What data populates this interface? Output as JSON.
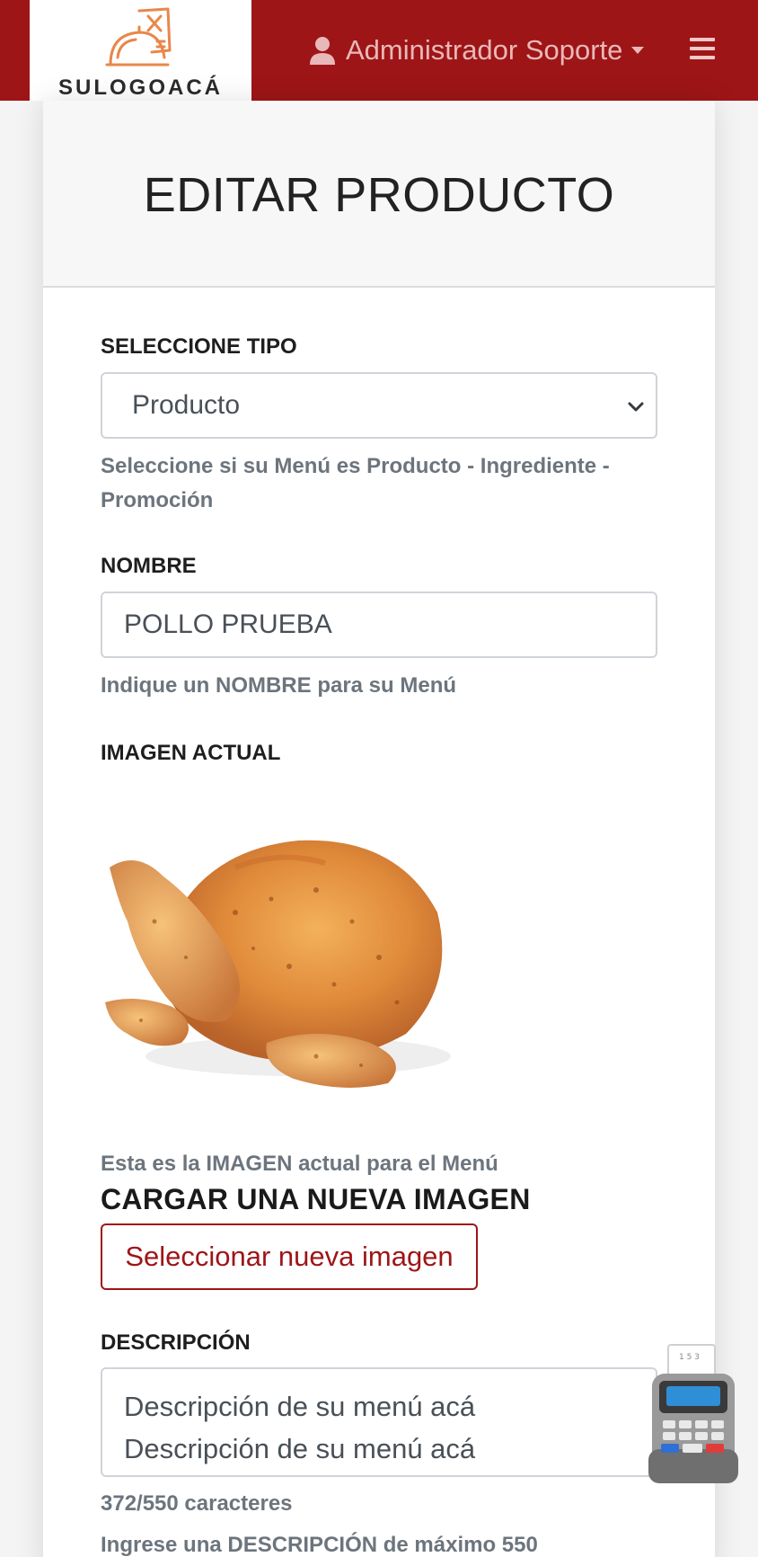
{
  "navbar": {
    "brand_name": "SULOGOACÁ",
    "user_name": "Administrador Soporte",
    "colors": {
      "primary": "#9e1517",
      "brand_bg": "#ffffff"
    }
  },
  "page": {
    "title": "EDITAR PRODUCTO"
  },
  "form": {
    "tipo": {
      "label": "SELECCIONE TIPO",
      "selected": "Producto",
      "help": "Seleccione si su Menú es Producto - Ingrediente - Promoción"
    },
    "nombre": {
      "label": "NOMBRE",
      "value": "POLLO PRUEBA",
      "help": "Indique un NOMBRE para su Menú"
    },
    "imagen_actual": {
      "label": "IMAGEN ACTUAL",
      "help": "Esta es la IMAGEN actual para el Menú"
    },
    "nueva_imagen": {
      "title": "CARGAR UNA NUEVA IMAGEN",
      "button_label": "Seleccionar nueva imagen"
    },
    "descripcion": {
      "label": "DESCRIPCIÓN",
      "lines": [
        "Descripción de su menú acá",
        "Descripción de su menú acá"
      ],
      "counter": "372/550 caracteres",
      "help": "Ingrese una DESCRIPCIÓN de máximo 550"
    }
  },
  "icons": [
    "logo-icon",
    "user-icon",
    "caret-down-icon",
    "menu-icon",
    "chevron-down-icon",
    "cash-register-icon"
  ]
}
